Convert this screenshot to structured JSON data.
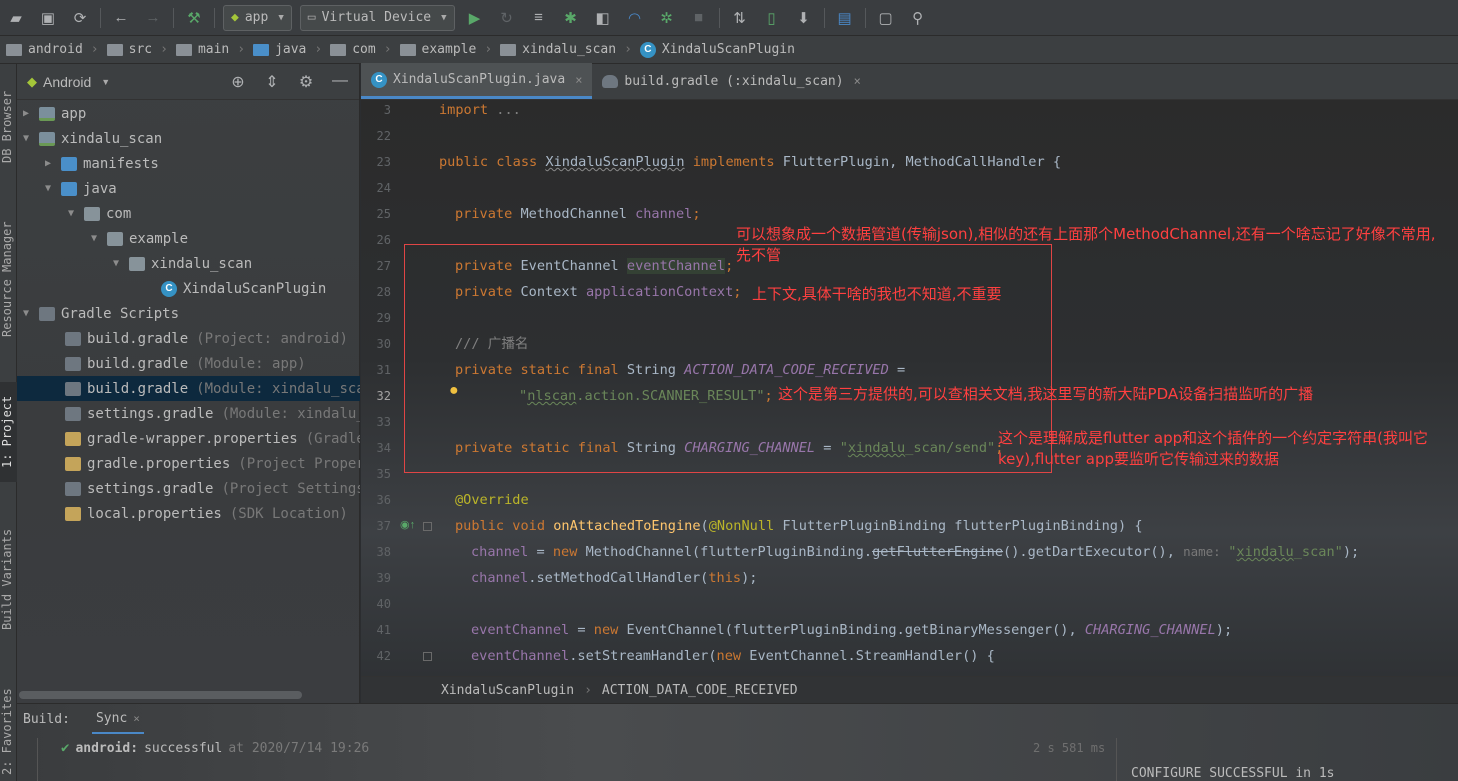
{
  "toolbar": {
    "run_config": "app",
    "device": "Virtual Device"
  },
  "breadcrumb": [
    "android",
    "src",
    "main",
    "java",
    "com",
    "example",
    "xindalu_scan",
    "XindaluScanPlugin"
  ],
  "left_strip": {
    "tabs": [
      "DB Browser",
      "Resource Manager",
      "1: Project",
      "Build Variants",
      "2: Favorites"
    ]
  },
  "project_panel": {
    "view": "Android",
    "tree": [
      {
        "label": "app",
        "hint": ""
      },
      {
        "label": "xindalu_scan",
        "hint": ""
      },
      {
        "label": "manifests",
        "hint": ""
      },
      {
        "label": "java",
        "hint": ""
      },
      {
        "label": "com",
        "hint": ""
      },
      {
        "label": "example",
        "hint": ""
      },
      {
        "label": "xindalu_scan",
        "hint": ""
      },
      {
        "label": "XindaluScanPlugin",
        "hint": ""
      },
      {
        "label": "Gradle Scripts",
        "hint": ""
      },
      {
        "label": "build.gradle",
        "hint": "(Project: android)"
      },
      {
        "label": "build.gradle",
        "hint": "(Module: app)"
      },
      {
        "label": "build.gradle",
        "hint": "(Module: xindalu_scan"
      },
      {
        "label": "settings.gradle",
        "hint": "(Module: xindalu_s"
      },
      {
        "label": "gradle-wrapper.properties",
        "hint": "(Gradle"
      },
      {
        "label": "gradle.properties",
        "hint": "(Project Propert"
      },
      {
        "label": "settings.gradle",
        "hint": "(Project Settings)"
      },
      {
        "label": "local.properties",
        "hint": "(SDK Location)"
      }
    ]
  },
  "editor": {
    "tabs": [
      {
        "label": "XindaluScanPlugin.java",
        "close": "×"
      },
      {
        "label": "build.gradle (:xindalu_scan)",
        "close": "×"
      }
    ],
    "line_numbers": [
      "3",
      "22",
      "23",
      "24",
      "25",
      "26",
      "27",
      "28",
      "29",
      "30",
      "31",
      "32",
      "33",
      "34",
      "35",
      "36",
      "37",
      "38",
      "39",
      "40",
      "41",
      "42"
    ],
    "code": {
      "l3_import": "import",
      "l3_dots": "...",
      "l23_a": "public class ",
      "l23_name": "XindaluScanPlugin",
      "l23_b": " implements ",
      "l23_c": "FlutterPlugin, MethodCallHandler {",
      "l25_a": "private ",
      "l25_b": "MethodChannel ",
      "l25_c": "channel",
      "l25_d": ";",
      "l27_a": "private ",
      "l27_b": "EventChannel ",
      "l27_c": "eventChannel",
      "l27_d": ";",
      "l28_a": "private ",
      "l28_b": "Context ",
      "l28_c": "applicationContext",
      "l28_d": ";",
      "l30": "/// 广播名",
      "l31_a": "private static final ",
      "l31_b": "String ",
      "l31_c": "ACTION_DATA_CODE_RECEIVED",
      "l31_d": " =",
      "l32_q1": "\"",
      "l32_sq": "nlscan",
      "l32_rest": ".action.SCANNER_RESULT\"",
      "l32_semi": ";",
      "l34_a": "private static final ",
      "l34_b": "String ",
      "l34_c": "CHARGING_CHANNEL",
      "l34_d": " = ",
      "l34_q": "\"",
      "l34_sq": "xindalu",
      "l34_rest": "_scan/send\"",
      "l34_semi": ";",
      "l36": "@Override",
      "l37_a": "public void ",
      "l37_b": "onAttachedToEngine",
      "l37_c": "(",
      "l37_d": "@NonNull",
      "l37_e": " FlutterPluginBinding flutterPluginBinding) {",
      "l38_a": "channel",
      "l38_b": " = ",
      "l38_c": "new ",
      "l38_d": "MethodChannel(flutterPluginBinding.",
      "l38_e": "getFlutterEngine",
      "l38_f": "().getDartExecutor(), ",
      "l38_g": "name: ",
      "l38_h": "\"",
      "l38_i": "xindalu",
      "l38_j": "_scan\"",
      "l38_k": ");",
      "l39_a": "channel",
      "l39_b": ".setMethodCallHandler(",
      "l39_c": "this",
      "l39_d": ");",
      "l41_a": "eventChannel",
      "l41_b": " = ",
      "l41_c": "new ",
      "l41_d": "EventChannel(flutterPluginBinding.getBinaryMessenger(), ",
      "l41_e": "CHARGING_CHANNEL",
      "l41_f": ");",
      "l42_a": "eventChannel",
      "l42_b": ".setStreamHandler(",
      "l42_c": "new ",
      "l42_d": "EventChannel.StreamHandler() {"
    },
    "annotations": {
      "a1": "可以想象成一个数据管道(传输json),相似的还有上面那个MethodChannel,还有一个啥忘记了好像不常用,先不管",
      "a2": "上下文,具体干啥的我也不知道,不重要",
      "a3": "这个是第三方提供的,可以查相关文档,我这里写的新大陆PDA设备扫描监听的广播",
      "a4": "这个是理解成是flutter app和这个插件的一个约定字符串(我叫它key),flutter app要监听它传输过来的数据"
    },
    "status_breadcrumb": [
      "XindaluScanPlugin",
      "ACTION_DATA_CODE_RECEIVED"
    ]
  },
  "build": {
    "label": "Build:",
    "tab": "Sync",
    "close": "×",
    "row_title": "android:",
    "row_status": "successful",
    "row_time": "at 2020/7/14 19:26",
    "duration": "2 s 581 ms",
    "output": "CONFIGURE SUCCESSFUL in 1s"
  }
}
